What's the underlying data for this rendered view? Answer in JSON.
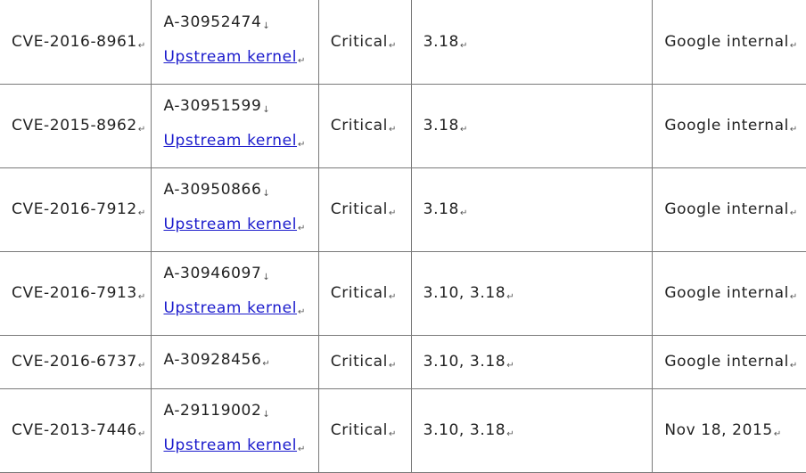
{
  "rows": [
    {
      "cve": "CVE-2016-8961",
      "bug": "A-30952474",
      "bug_mark": "down",
      "link": "Upstream kernel",
      "severity": "Critical",
      "versions": "3.18",
      "reported": "Google internal"
    },
    {
      "cve": "CVE-2015-8962",
      "bug": "A-30951599",
      "bug_mark": "down",
      "link": "Upstream kernel",
      "severity": "Critical",
      "versions": "3.18",
      "reported": "Google internal"
    },
    {
      "cve": "CVE-2016-7912",
      "bug": "A-30950866",
      "bug_mark": "down",
      "link": "Upstream kernel",
      "severity": "Critical",
      "versions": "3.18",
      "reported": "Google internal"
    },
    {
      "cve": "CVE-2016-7913",
      "bug": "A-30946097",
      "bug_mark": "down",
      "link": "Upstream kernel",
      "severity": "Critical",
      "versions": "3.10, 3.18",
      "reported": "Google internal"
    },
    {
      "cve": "CVE-2016-6737",
      "bug": "A-30928456",
      "bug_mark": "ret",
      "link": "",
      "severity": "Critical",
      "versions": "3.10, 3.18",
      "reported": "Google internal"
    },
    {
      "cve": "CVE-2013-7446",
      "bug": "A-29119002",
      "bug_mark": "down",
      "link": "Upstream kernel",
      "severity": "Critical",
      "versions": "3.10, 3.18",
      "reported": "Nov 18, 2015"
    }
  ]
}
